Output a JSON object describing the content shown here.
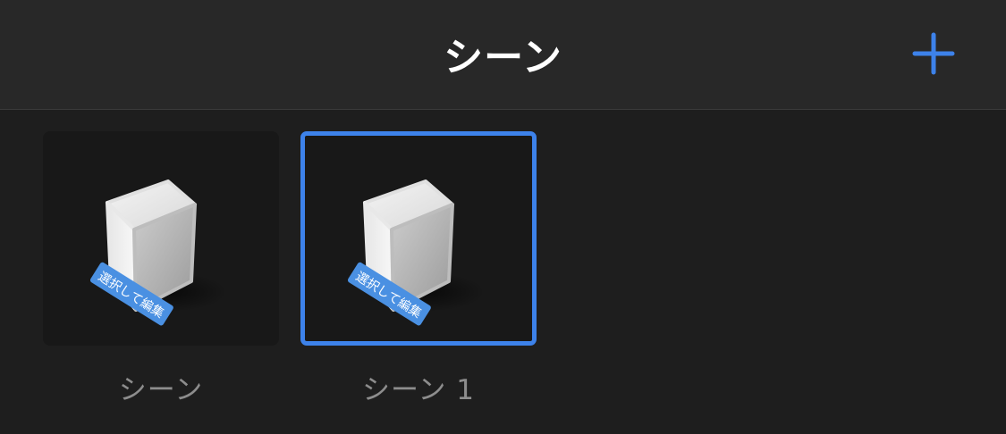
{
  "header": {
    "title": "シーン",
    "add_icon": "plus-icon"
  },
  "scenes": [
    {
      "label": "シーン",
      "badge": "選択して編集",
      "selected": false
    },
    {
      "label": "シーン 1",
      "badge": "選択して編集",
      "selected": true
    }
  ],
  "colors": {
    "accent": "#3d82ea",
    "header_bg": "#282828",
    "content_bg": "#1e1e1e",
    "thumb_bg": "#181818",
    "label": "#8d8d8d",
    "title": "#ffffff"
  }
}
